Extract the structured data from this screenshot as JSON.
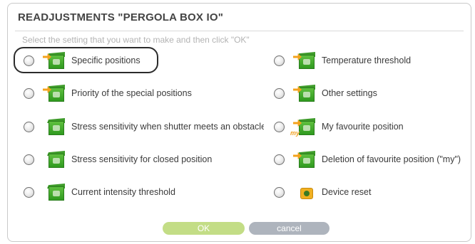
{
  "dialog": {
    "title": "READJUSTMENTS \"PERGOLA BOX IO\"",
    "instruction": "Select the setting that you want to make and then click \"OK\""
  },
  "options": [
    {
      "label": "Specific positions",
      "icon": "specific-positions-icon",
      "selected_highlight": true
    },
    {
      "label": "Priority of the special positions",
      "icon": "priority-icon"
    },
    {
      "label": "Stress sensitivity when shutter meets an obstacle",
      "icon": "stress-obstacle-icon"
    },
    {
      "label": "Stress sensitivity for closed position",
      "icon": "stress-closed-icon"
    },
    {
      "label": "Current intensity threshold",
      "icon": "intensity-icon"
    },
    {
      "label": "Temperature threshold",
      "icon": "temperature-icon"
    },
    {
      "label": "Other settings",
      "icon": "other-settings-icon"
    },
    {
      "label": "My favourite position",
      "icon": "favourite-icon",
      "tag": "my"
    },
    {
      "label": "Deletion of favourite position (\"my\")",
      "icon": "delete-favourite-icon"
    },
    {
      "label": "Device reset",
      "icon": "device-reset-icon"
    }
  ],
  "buttons": {
    "ok": "OK",
    "cancel": "cancel"
  },
  "colors": {
    "icon_green": "#2f9a1f",
    "icon_orange": "#f3a21b",
    "ok_button": "#c3dd86",
    "cancel_button": "#aeb4bd"
  }
}
